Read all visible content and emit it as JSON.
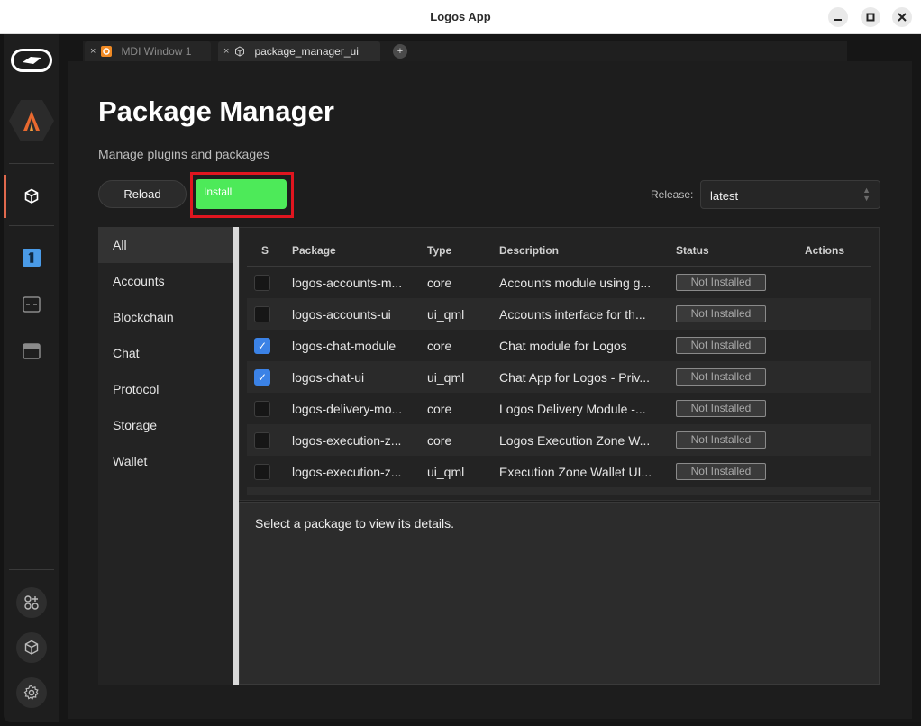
{
  "window": {
    "title": "Logos App"
  },
  "tabs": [
    {
      "label": "MDI Window 1",
      "close": "×"
    },
    {
      "label": "package_manager_ui",
      "close": "×"
    }
  ],
  "tab_add": "+",
  "page": {
    "title": "Package Manager",
    "subtitle": "Manage plugins and packages"
  },
  "toolbar": {
    "reload_label": "Reload",
    "install_label": "Install",
    "release_label": "Release:",
    "release_value": "latest"
  },
  "categories": [
    "All",
    "Accounts",
    "Blockchain",
    "Chat",
    "Protocol",
    "Storage",
    "Wallet"
  ],
  "table": {
    "headers": [
      "S",
      "Package",
      "Type",
      "Description",
      "Status",
      "Actions"
    ],
    "rows": [
      {
        "checked": false,
        "package": "logos-accounts-m...",
        "type": "core",
        "description": "Accounts module using g...",
        "status": "Not Installed"
      },
      {
        "checked": false,
        "package": "logos-accounts-ui",
        "type": "ui_qml",
        "description": "Accounts interface for th...",
        "status": "Not Installed"
      },
      {
        "checked": true,
        "package": "logos-chat-module",
        "type": "core",
        "description": "Chat module for Logos",
        "status": "Not Installed"
      },
      {
        "checked": true,
        "package": "logos-chat-ui",
        "type": "ui_qml",
        "description": "Chat App for Logos - Priv...",
        "status": "Not Installed"
      },
      {
        "checked": false,
        "package": "logos-delivery-mo...",
        "type": "core",
        "description": "Logos Delivery Module -...",
        "status": "Not Installed"
      },
      {
        "checked": false,
        "package": "logos-execution-z...",
        "type": "core",
        "description": "Logos Execution Zone W...",
        "status": "Not Installed"
      },
      {
        "checked": false,
        "package": "logos-execution-z...",
        "type": "ui_qml",
        "description": "Execution Zone Wallet UI...",
        "status": "Not Installed"
      }
    ]
  },
  "details": {
    "placeholder": "Select a package to view its details."
  },
  "colors": {
    "install_button": "#4dea59",
    "highlight_frame": "#e0151f",
    "active_indicator": "#e0694d",
    "checkbox_checked": "#3b82e6"
  }
}
